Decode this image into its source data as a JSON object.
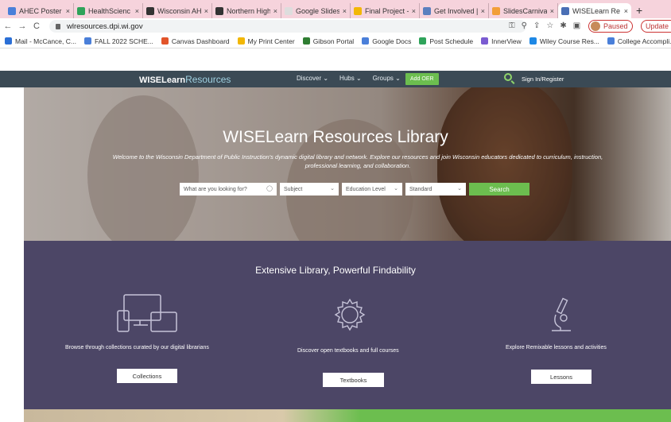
{
  "browser": {
    "tabs": [
      {
        "label": "AHEC Poster",
        "color": "#4a7fd9"
      },
      {
        "label": "HealthScienc",
        "color": "#2fa35a"
      },
      {
        "label": "Wisconsin AH",
        "color": "#333333"
      },
      {
        "label": "Northern High",
        "color": "#333333"
      },
      {
        "label": "Google Slides",
        "color": "#dddddd"
      },
      {
        "label": "Final Project -",
        "color": "#f2b705"
      },
      {
        "label": "Get Involved |",
        "color": "#5b7fbf"
      },
      {
        "label": "SlidesCarnival",
        "color": "#f29f38"
      },
      {
        "label": "WISELearn Re",
        "color": "#4a6fb5"
      }
    ],
    "new_tab": "+",
    "url": "wlresources.dpi.wi.gov",
    "paused_label": "Paused",
    "update_label": "Update",
    "bookmarks": [
      {
        "label": "Mail - McCance, C...",
        "color": "#2b6fd6"
      },
      {
        "label": "FALL 2022 SCHE...",
        "color": "#4a7fd9"
      },
      {
        "label": "Canvas Dashboard",
        "color": "#e2542a"
      },
      {
        "label": "My Print Center",
        "color": "#f2b705"
      },
      {
        "label": "Gibson Portal",
        "color": "#2f7d32"
      },
      {
        "label": "Google Docs",
        "color": "#4a7fd9"
      },
      {
        "label": "Post Schedule",
        "color": "#2fa35a"
      },
      {
        "label": "InnerView",
        "color": "#7a5bd1"
      },
      {
        "label": "Wiley Course Res...",
        "color": "#1e88e5"
      },
      {
        "label": "College Accompli...",
        "color": "#4a7fd9"
      }
    ]
  },
  "site": {
    "logo_bold": "WISELearn",
    "logo_light": "Resources",
    "nav": [
      "Discover ⌄",
      "Hubs ⌄",
      "Groups ⌄"
    ],
    "add_oer": "Add OER",
    "signin": "Sign In/Register"
  },
  "hero": {
    "title": "WISELearn Resources Library",
    "subtitle": "Welcome to the Wisconsin Department of Public Instruction's dynamic digital library and network. Explore our resources and join Wisconsin educators dedicated to curriculum, instruction, professional learning, and collaboration.",
    "search_placeholder": "What are you looking for?",
    "subject": "Subject",
    "education_level": "Education Level",
    "standard": "Standard",
    "search_button": "Search"
  },
  "features": {
    "title": "Extensive Library, Powerful Findability",
    "items": [
      {
        "text": "Browse through collections curated by our digital librarians",
        "button": "Collections"
      },
      {
        "text": "Discover open textbooks and full courses",
        "button": "Textbooks"
      },
      {
        "text": "Explore Remixable lessons and activities",
        "button": "Lessons"
      }
    ]
  }
}
